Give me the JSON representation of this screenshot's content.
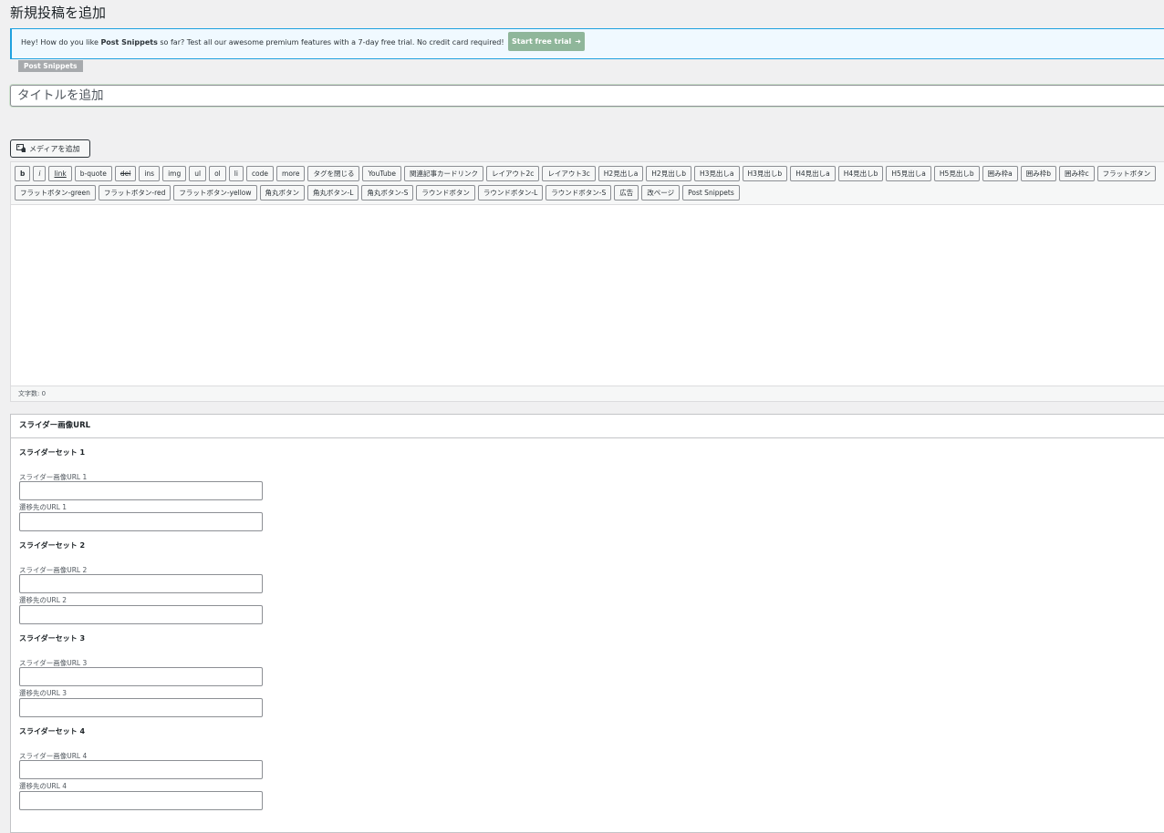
{
  "page": {
    "title": "新規投稿を追加"
  },
  "notice": {
    "text_before": "Hey! How do you like ",
    "text_strong": "Post Snippets",
    "text_after": " so far? Test all our awesome premium features with a 7-day free trial. No credit card required!",
    "button_label": "Start free trial",
    "button_arrow": "➜",
    "tag_label": "Post Snippets"
  },
  "title_input": {
    "placeholder": "タイトルを追加"
  },
  "media_button": {
    "label": "メディアを追加",
    "icon": "media-icon"
  },
  "toolbar": {
    "row1": [
      "b",
      "i",
      "link",
      "b-quote",
      "del",
      "ins",
      "img",
      "ul",
      "ol",
      "li",
      "code",
      "more",
      "タグを閉じる",
      "YouTube",
      "関連記事カードリンク",
      "レイアウト2c",
      "レイアウト3c",
      "H2見出しa",
      "H2見出しb",
      "H3見出しa",
      "H3見出しb",
      "H4見出しa",
      "H4見出しb",
      "H5見出しa",
      "H5見出しb",
      "囲み枠a",
      "囲み枠b",
      "囲み枠c",
      "フラットボタン"
    ],
    "row2": [
      "フラットボタン-green",
      "フラットボタン-red",
      "フラットボタン-yellow",
      "角丸ボタン",
      "角丸ボタン-L",
      "角丸ボタン-S",
      "ラウンドボタン",
      "ラウンドボタン-L",
      "ラウンドボタン-S",
      "広告",
      "改ページ",
      "Post Snippets"
    ]
  },
  "editor": {
    "word_count": "文字数: 0"
  },
  "metabox": {
    "title": "スライダー画像URL",
    "sets": [
      {
        "title": "スライダーセット 1",
        "image_label": "スライダー画像URL 1",
        "link_label": "遷移先のURL 1",
        "image_value": "",
        "link_value": ""
      },
      {
        "title": "スライダーセット 2",
        "image_label": "スライダー画像URL 2",
        "link_label": "遷移先のURL 2",
        "image_value": "",
        "link_value": ""
      },
      {
        "title": "スライダーセット 3",
        "image_label": "スライダー画像URL 3",
        "link_label": "遷移先のURL 3",
        "image_value": "",
        "link_value": ""
      },
      {
        "title": "スライダーセット 4",
        "image_label": "スライダー画像URL 4",
        "link_label": "遷移先のURL 4",
        "image_value": "",
        "link_value": ""
      }
    ]
  }
}
